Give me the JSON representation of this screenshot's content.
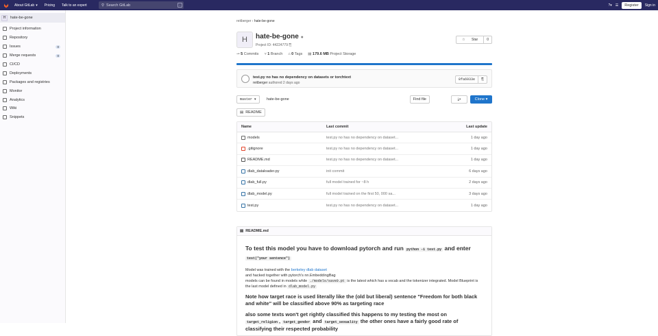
{
  "topbar": {
    "about": "About GitLab",
    "pricing": "Pricing",
    "talk": "Talk to an expert",
    "search_placeholder": "Search GitLab",
    "search_key": "/",
    "register": "Register",
    "signin": "Sign in"
  },
  "sidebar": {
    "project_initial": "H",
    "project_name": "hate-be-gone",
    "items": [
      {
        "label": "Project information",
        "icon": "info-icon"
      },
      {
        "label": "Repository",
        "icon": "repo-icon"
      },
      {
        "label": "Issues",
        "icon": "issues-icon",
        "count": "0"
      },
      {
        "label": "Merge requests",
        "icon": "merge-request-icon",
        "count": "0"
      },
      {
        "label": "CI/CD",
        "icon": "rocket-icon"
      },
      {
        "label": "Deployments",
        "icon": "deploy-icon"
      },
      {
        "label": "Packages and registries",
        "icon": "package-icon"
      },
      {
        "label": "Monitor",
        "icon": "monitor-icon"
      },
      {
        "label": "Analytics",
        "icon": "chart-icon"
      },
      {
        "label": "Wiki",
        "icon": "book-icon"
      },
      {
        "label": "Snippets",
        "icon": "scissors-icon"
      }
    ]
  },
  "breadcrumb": {
    "owner": "reitberger",
    "project": "hate-be-gone"
  },
  "project": {
    "initial": "H",
    "title": "hate-be-gone",
    "id_label": "Project ID: 44224779",
    "star": "Star",
    "star_count": "0",
    "commits_num": "5",
    "commits_label": "Commits",
    "branches_num": "1",
    "branches_label": "Branch",
    "tags_num": "0",
    "tags_label": "Tags",
    "storage_num": "179.6 MB",
    "storage_label": "Project Storage"
  },
  "last_commit": {
    "message": "test.py no has no dependency on datasets or torchtext",
    "author": "reitberger",
    "authored": "authored 2 days ago",
    "sha": "8fa6933e"
  },
  "tools": {
    "branch": "master",
    "path": "hate-be-gone",
    "find_file": "Find file",
    "clone": "Clone",
    "readme_button": "README"
  },
  "table": {
    "headers": {
      "name": "Name",
      "commit": "Last commit",
      "update": "Last update"
    },
    "rows": [
      {
        "name": "models",
        "icon": "folder-icon",
        "commit": "test.py no has no dependency on dataset...",
        "update": "1 day ago"
      },
      {
        "name": ".gitignore",
        "icon": "git-icon",
        "commit": "test.py no has no dependency on dataset...",
        "update": "1 day ago"
      },
      {
        "name": "README.md",
        "icon": "markdown-icon",
        "commit": "test.py no has no dependency on dataset...",
        "update": "1 day ago"
      },
      {
        "name": "dlab_dataloader.py",
        "icon": "python-icon",
        "commit": "init commit",
        "update": "6 days ago"
      },
      {
        "name": "dlab_full.py",
        "icon": "python-icon",
        "commit": "full model trained for ~8 h",
        "update": "2 days ago"
      },
      {
        "name": "dlab_model.py",
        "icon": "python-icon",
        "commit": "full model trained on the first 50, 000 sa...",
        "update": "3 days ago"
      },
      {
        "name": "test.py",
        "icon": "python-icon",
        "commit": "test.py no has no dependency on dataset...",
        "update": "1 day ago"
      }
    ]
  },
  "readme": {
    "file": "README.md",
    "h1_a": "To test this model you have to download pytorch and run ",
    "h1_code1": "python -i test.py",
    "h1_b": " and enter ",
    "h1_code2": "test(\"your sentence\")",
    "p1_a": "Model was trained with the ",
    "p1_link": "berkeley dlab dataset",
    "p1_b": "and hacked together with pytorch's nn.EmbeddingBag",
    "p1_c": "models can be found in models while ",
    "p1_code1": "./models/save0.pt",
    "p1_d": " is the latest which has a vocab and the tokenizer integrated. Model Blueprint is the last model defined in ",
    "p1_code2": "dlab_model.py",
    "h2": "Note how target race is used literally like the (old but liberal) sentence \"Freedom for both black and white\" will be classified above 90% as targeting race",
    "h3_a": "also some texts won't get rightly classified this happens to my testing the most on ",
    "h3_code1": "target_religion",
    "h3_code2": "target_gender",
    "h3_and": " and ",
    "h3_code3": "target_sexuality",
    "h3_b": " the other ones have a fairly good rate of classifying their respected probability"
  }
}
